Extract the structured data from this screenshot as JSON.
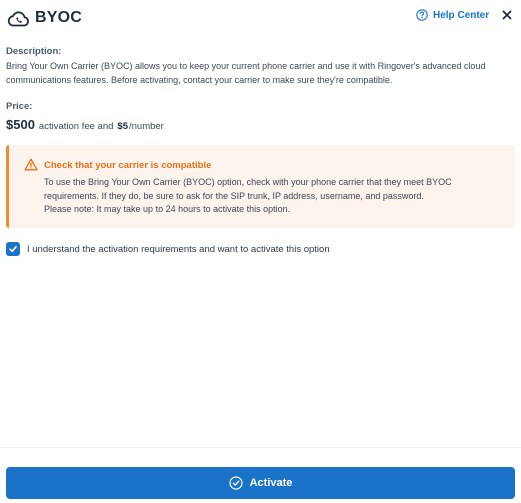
{
  "header": {
    "title": "BYOC",
    "brand_icon": "cloud-phone-icon",
    "help_label": "Help Center",
    "help_icon": "question-circle-icon",
    "close_icon": "close-icon"
  },
  "description": {
    "label": "Description:",
    "text": "Bring Your Own Carrier (BYOC) allows you to keep your current phone carrier and use it with Ringover's advanced cloud communications features. Before activating, contact your carrier to make sure they're compatible."
  },
  "price": {
    "label": "Price:",
    "activation_amount": "$500",
    "activation_text": "activation fee and",
    "number_amount": "$5",
    "number_text": "/number"
  },
  "warning": {
    "icon": "warning-triangle-icon",
    "title": "Check that your carrier is compatible",
    "line1": "To use the Bring Your Own Carrier (BYOC) option, check with your phone carrier that they meet BYOC",
    "line2": "requirements. If they do, be sure to ask for the SIP trunk, IP address, username, and password.",
    "line3": "Please note: It may take up to 24 hours to activate this option.",
    "accent_color": "#f28a2e",
    "background_color": "#fdf3ed"
  },
  "agreement": {
    "checked": true,
    "label": "I understand the activation requirements and want to activate this option"
  },
  "footer": {
    "activate_label": "Activate",
    "activate_icon": "check-circle-icon",
    "primary_color": "#1a73c8"
  }
}
